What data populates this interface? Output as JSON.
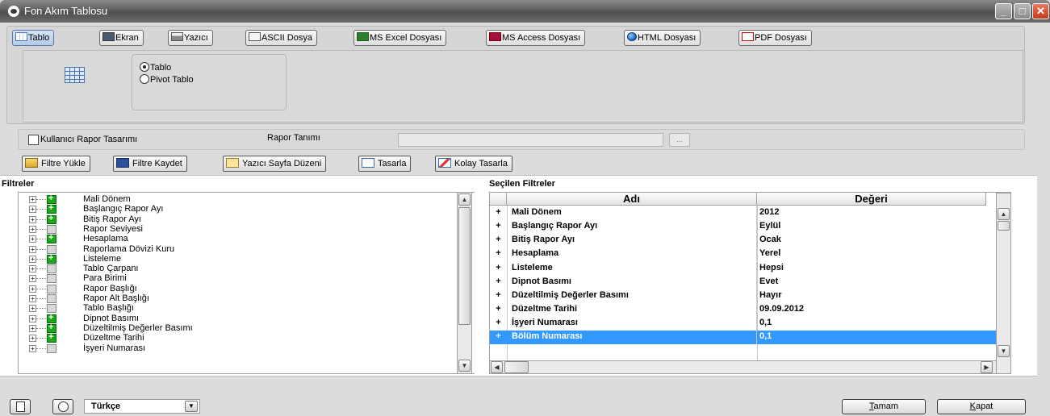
{
  "window": {
    "title": "Fon Akım Tablosu",
    "buttons": {
      "minimize": "_",
      "maximize": "□",
      "close": "✕"
    }
  },
  "output_tabs": [
    {
      "label": "Tablo",
      "icon": "table-icon",
      "active": true
    },
    {
      "label": "Ekran",
      "icon": "screen-icon",
      "active": false
    },
    {
      "label": "Yazıcı",
      "icon": "printer-icon",
      "active": false
    },
    {
      "label": "ASCII Dosya",
      "icon": "ascii-file-icon",
      "active": false
    },
    {
      "label": "MS Excel Dosyası",
      "icon": "excel-icon",
      "active": false
    },
    {
      "label": "MS Access Dosyası",
      "icon": "access-icon",
      "active": false
    },
    {
      "label": "HTML Dosyası",
      "icon": "html-globe-icon",
      "active": false
    },
    {
      "label": "PDF Dosyası",
      "icon": "pdf-icon",
      "active": false
    }
  ],
  "table_options": {
    "option1": "Tablo",
    "option2": "Pivot Tablo",
    "selected": "Tablo"
  },
  "rapor": {
    "checkbox_label": "Kullanıcı Rapor Tasarımı",
    "tanim_label": "Rapor Tanımı",
    "tanim_value": "",
    "dots": "..."
  },
  "toolbar": {
    "filtre_yukle": "Filtre Yükle",
    "filtre_kaydet": "Filtre Kaydet",
    "yazici_sayfa": "Yazıcı Sayfa Düzeni",
    "tasarla": "Tasarla",
    "kolay_tasarla": "Kolay Tasarla"
  },
  "filters": {
    "title": "Filtreler",
    "items": [
      {
        "label": "Mali Dönem",
        "active": true
      },
      {
        "label": "Başlangıç Rapor Ayı",
        "active": true
      },
      {
        "label": "Bitiş Rapor Ayı",
        "active": true
      },
      {
        "label": "Rapor Seviyesi",
        "active": false
      },
      {
        "label": "Hesaplama",
        "active": true
      },
      {
        "label": "Raporlama Dövizi Kuru",
        "active": false
      },
      {
        "label": "Listeleme",
        "active": true
      },
      {
        "label": "Tablo Çarpanı",
        "active": false
      },
      {
        "label": "Para Birimi",
        "active": false
      },
      {
        "label": "Rapor Başlığı",
        "active": false
      },
      {
        "label": "Rapor Alt Başlığı",
        "active": false
      },
      {
        "label": "Tablo Başlığı",
        "active": false
      },
      {
        "label": "Dipnot Basımı",
        "active": true
      },
      {
        "label": "Düzeltilmiş Değerler Basımı",
        "active": true
      },
      {
        "label": "Düzeltme Tarihi",
        "active": true
      },
      {
        "label": "İşyeri Numarası",
        "active": false
      }
    ]
  },
  "selected_filters": {
    "title": "Seçilen Filtreler",
    "columns": {
      "name": "Adı",
      "value": "Değeri"
    },
    "rows": [
      {
        "plus": "+",
        "name": "Mali Dönem",
        "value": "2012"
      },
      {
        "plus": "+",
        "name": "Başlangıç Rapor Ayı",
        "value": "Eylül"
      },
      {
        "plus": "+",
        "name": "Bitiş Rapor Ayı",
        "value": "Ocak"
      },
      {
        "plus": "+",
        "name": "Hesaplama",
        "value": "Yerel"
      },
      {
        "plus": "+",
        "name": "Listeleme",
        "value": "Hepsi"
      },
      {
        "plus": "+",
        "name": "Dipnot Basımı",
        "value": "Evet"
      },
      {
        "plus": "+",
        "name": "Düzeltilmiş Değerler Basımı",
        "value": "Hayır"
      },
      {
        "plus": "+",
        "name": "Düzeltme Tarihi",
        "value": "09.09.2012"
      },
      {
        "plus": "+",
        "name": "İşyeri  Numarası",
        "value": "0,1"
      },
      {
        "plus": "+",
        "name": "Bölüm Numarası",
        "value": "0,1"
      }
    ],
    "selected_row": 9
  },
  "scroll": {
    "up": "▲",
    "down": "▼",
    "left": "◀",
    "right": "▶"
  },
  "bottom": {
    "language": "Türkçe",
    "ok_label_first": "T",
    "ok_label_rest": "amam",
    "close_label_first": "K",
    "close_label_rest": "apat",
    "filtre_yukle_key": "Y",
    "filtre_kaydet_key": "K"
  },
  "colors": {
    "selection": "#3399ff",
    "title_bar": "#5e5e5e",
    "close_button": "#c8381c"
  }
}
